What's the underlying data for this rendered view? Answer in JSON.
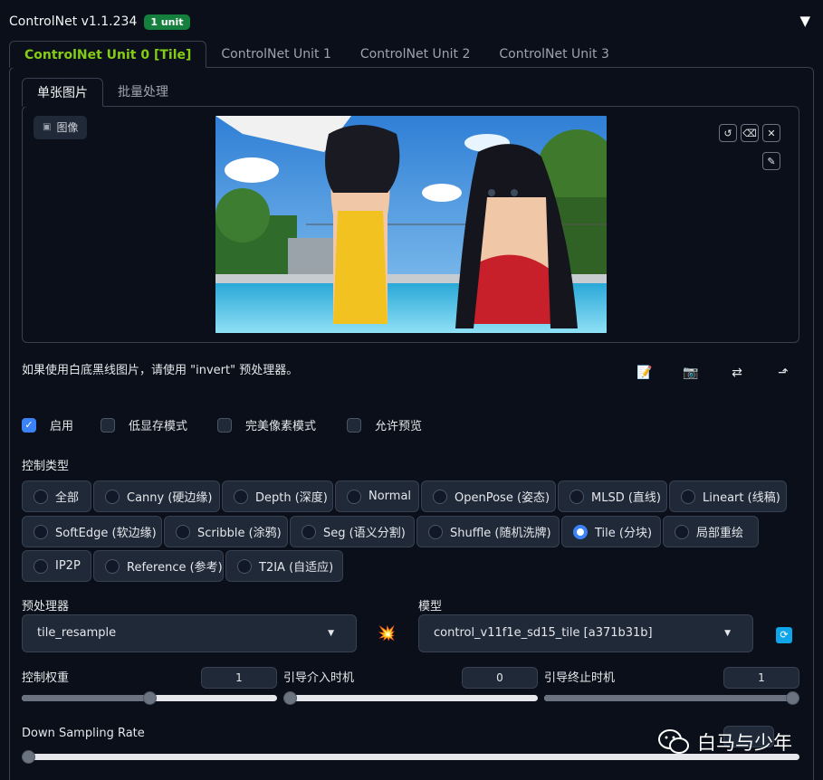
{
  "header": {
    "title": "ControlNet v1.1.234",
    "badge": "1 unit",
    "collapse_icon": "triangle-down-icon"
  },
  "unit_tabs": [
    {
      "label": "ControlNet Unit 0 [Tile]",
      "active": true
    },
    {
      "label": "ControlNet Unit 1",
      "active": false
    },
    {
      "label": "ControlNet Unit 2",
      "active": false
    },
    {
      "label": "ControlNet Unit 3",
      "active": false
    }
  ],
  "image_tabs": [
    {
      "label": "单张图片",
      "active": true
    },
    {
      "label": "批量处理",
      "active": false
    }
  ],
  "image_panel": {
    "label": "图像",
    "tools": [
      "undo-icon",
      "eraser-icon",
      "close-icon",
      "brush-icon"
    ]
  },
  "hint": "如果使用白底黑线图片，请使用 \"invert\" 预处理器。",
  "actions": [
    "notepad-icon",
    "camera-icon",
    "swap-icon",
    "send-icon"
  ],
  "checkboxes": [
    {
      "label": "启用",
      "checked": true
    },
    {
      "label": "低显存模式",
      "checked": false
    },
    {
      "label": "完美像素模式",
      "checked": false
    },
    {
      "label": "允许预览",
      "checked": false
    }
  ],
  "control_type": {
    "label": "控制类型",
    "options": [
      "全部",
      "Canny (硬边缘)",
      "Depth (深度)",
      "Normal",
      "OpenPose (姿态)",
      "MLSD (直线)",
      "Lineart (线稿)",
      "SoftEdge (软边缘)",
      "Scribble (涂鸦)",
      "Seg (语义分割)",
      "Shuffle (随机洗牌)",
      "Tile (分块)",
      "局部重绘",
      "IP2P",
      "Reference (参考)",
      "T2IA (自适应)"
    ],
    "selected": "Tile (分块)"
  },
  "preprocessor": {
    "label": "预处理器",
    "value": "tile_resample"
  },
  "model": {
    "label": "模型",
    "value": "control_v11f1e_sd15_tile [a371b31b]"
  },
  "sliders": {
    "weight": {
      "label": "控制权重",
      "value": "1",
      "fraction": 0.5
    },
    "start": {
      "label": "引导介入时机",
      "value": "0",
      "fraction": 0.0
    },
    "end": {
      "label": "引导终止时机",
      "value": "1",
      "fraction": 1.0
    },
    "down_sampling": {
      "label": "Down Sampling Rate",
      "fraction": 0.0
    }
  },
  "watermark": {
    "text": "白马与少年",
    "icon": "wechat-icon"
  },
  "colors": {
    "accent": "#84cc16",
    "badge": "#15803d",
    "primary": "#3b82f6",
    "background": "#0b0f19"
  }
}
